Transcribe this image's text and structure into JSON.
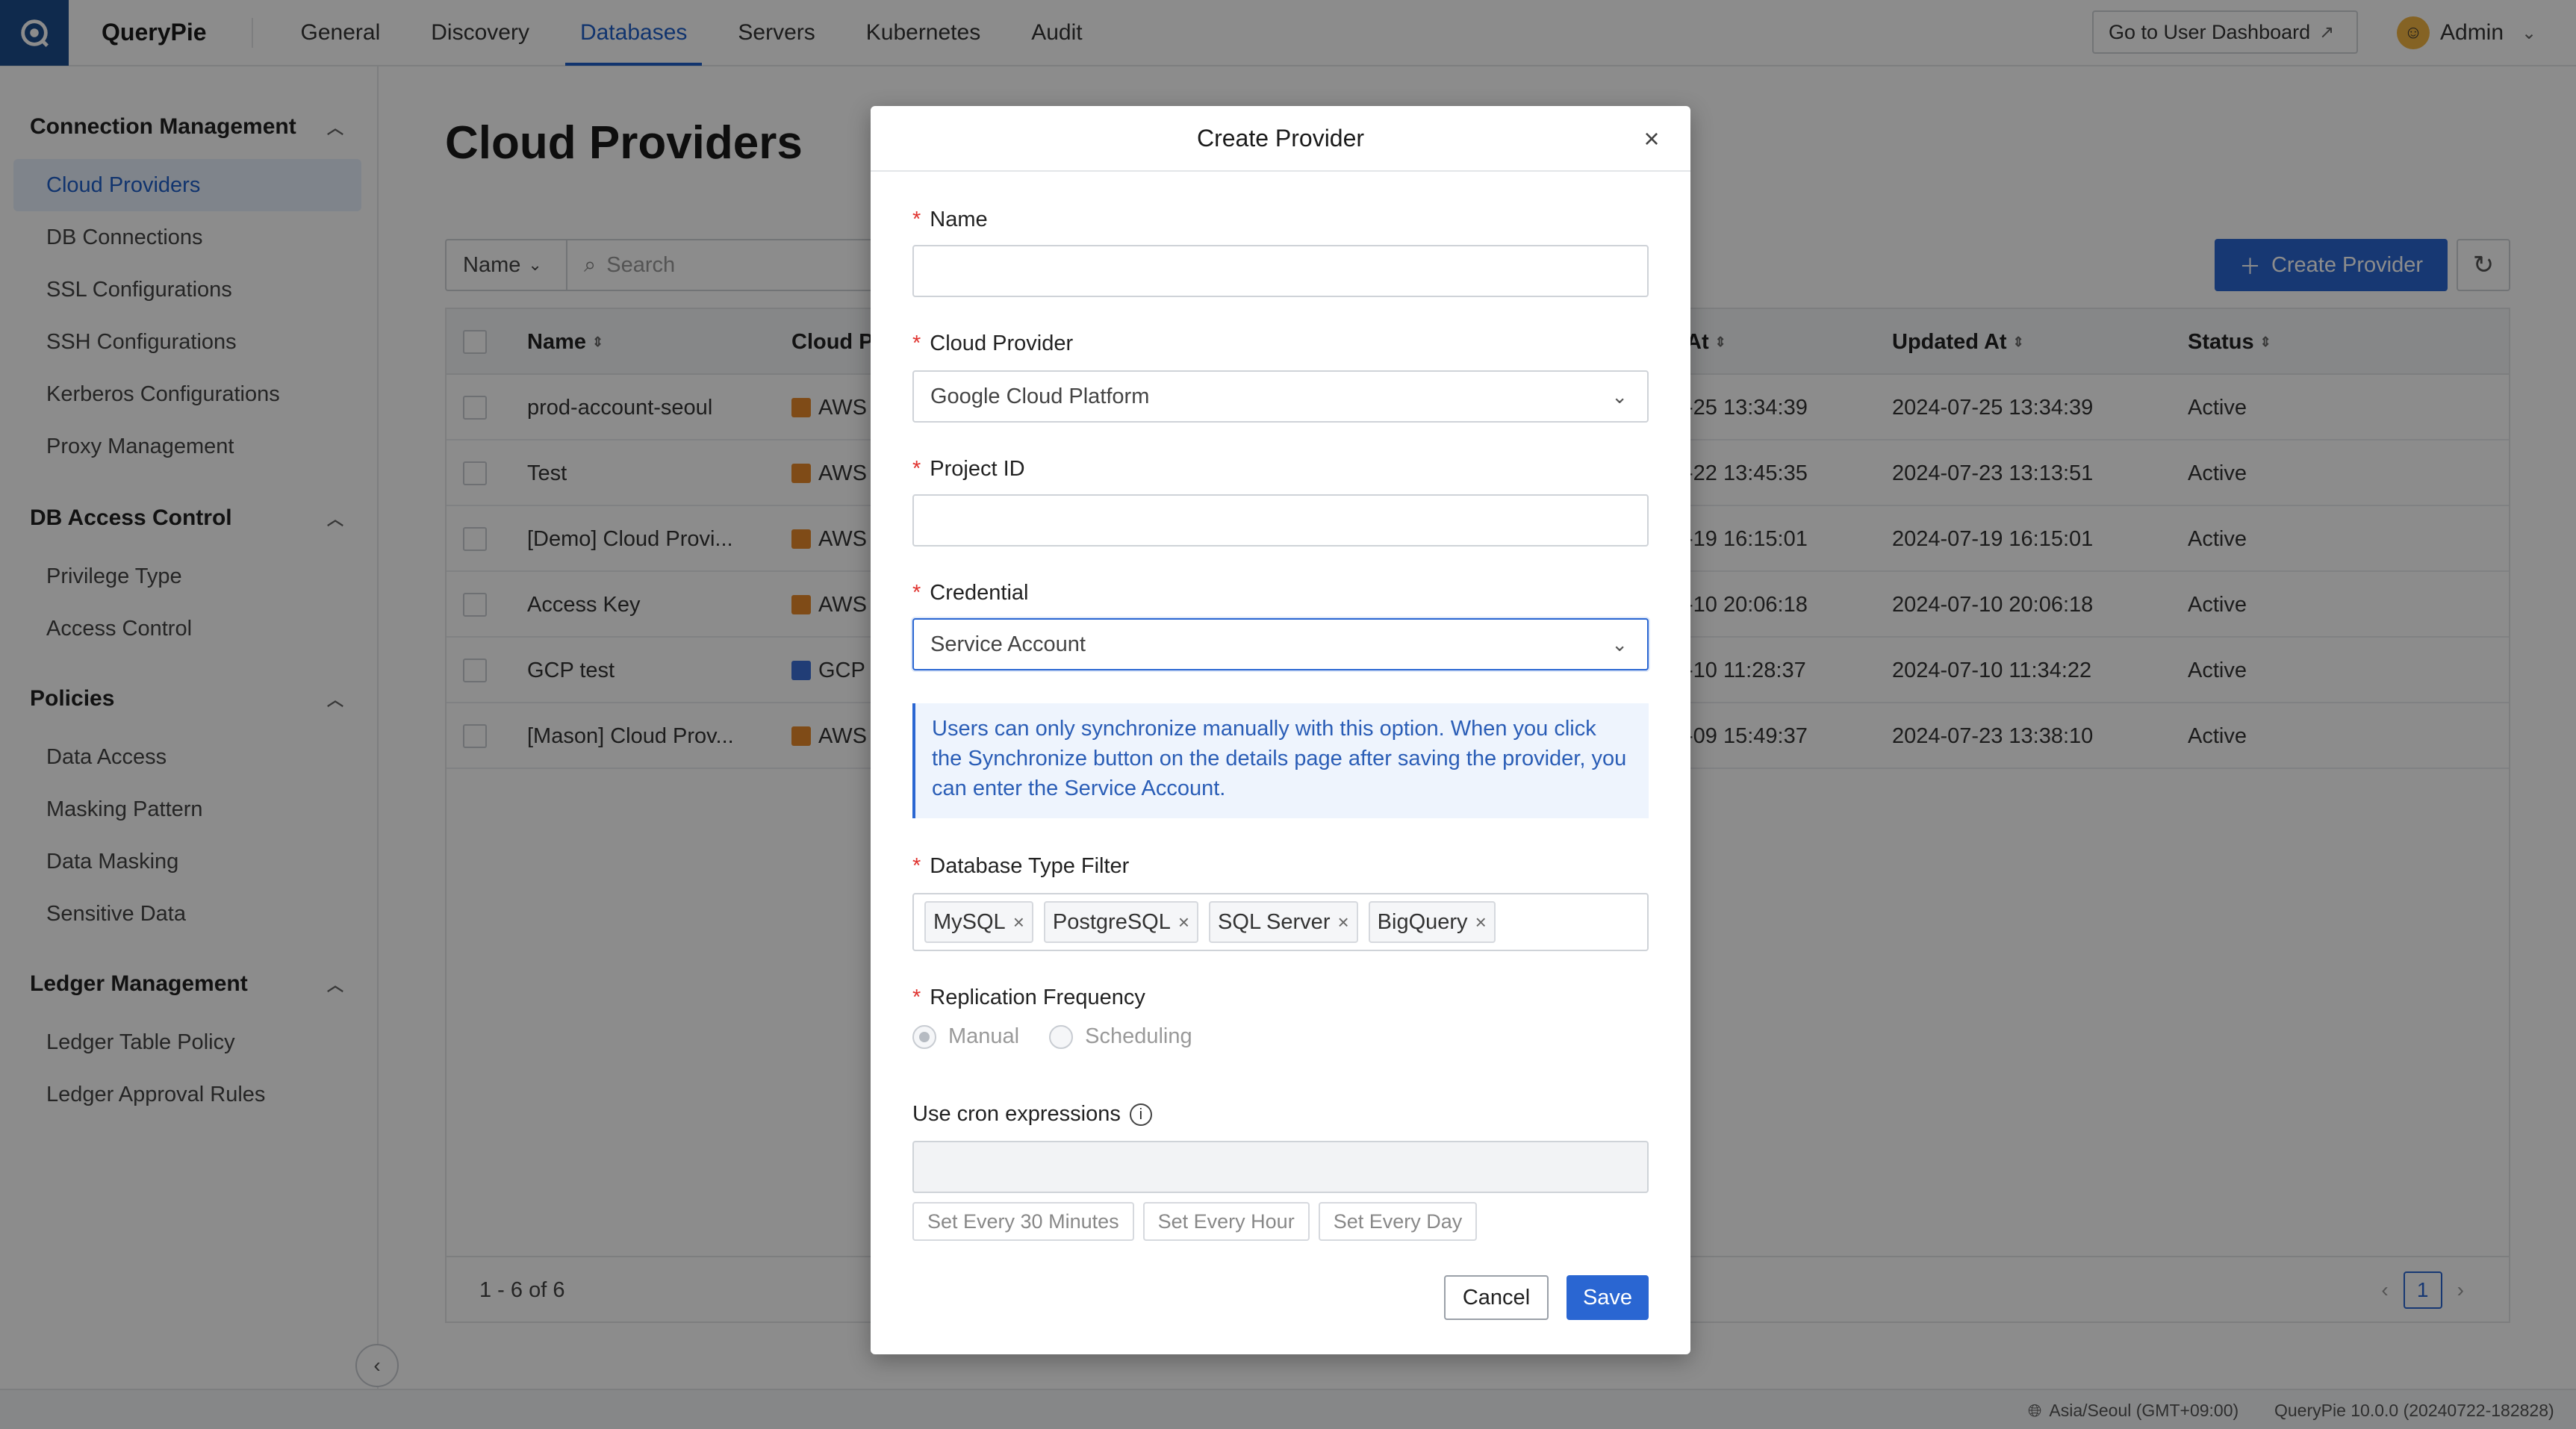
{
  "app": {
    "brand": "QueryPie"
  },
  "nav": {
    "items": [
      {
        "label": "General",
        "active": false
      },
      {
        "label": "Discovery",
        "active": false
      },
      {
        "label": "Databases",
        "active": true
      },
      {
        "label": "Servers",
        "active": false
      },
      {
        "label": "Kubernetes",
        "active": false
      },
      {
        "label": "Audit",
        "active": false
      }
    ],
    "dashboard_button": "Go to User Dashboard",
    "user": "Admin"
  },
  "sidebar": {
    "sections": [
      {
        "title": "Connection Management",
        "items": [
          "Cloud Providers",
          "DB Connections",
          "SSL Configurations",
          "SSH Configurations",
          "Kerberos Configurations",
          "Proxy Management"
        ]
      },
      {
        "title": "DB Access Control",
        "items": [
          "Privilege Type",
          "Access Control"
        ]
      },
      {
        "title": "Policies",
        "items": [
          "Data Access",
          "Masking Pattern",
          "Data Masking",
          "Sensitive Data"
        ]
      },
      {
        "title": "Ledger Management",
        "items": [
          "Ledger Table Policy",
          "Ledger Approval Rules"
        ]
      }
    ],
    "active_item": "Cloud Providers"
  },
  "page": {
    "title": "Cloud Providers",
    "filter_select": "Name",
    "search_placeholder": "Search",
    "create_button": "Create Provider"
  },
  "table": {
    "headers": {
      "name": "Name",
      "cloud_provider": "Cloud P",
      "created_at": "At",
      "updated_at": "Updated At",
      "status": "Status"
    },
    "rows": [
      {
        "name": "prod-account-seoul",
        "provider": "AWS",
        "created": "-25 13:34:39",
        "updated": "2024-07-25 13:34:39",
        "status": "Active"
      },
      {
        "name": "Test",
        "provider": "AWS",
        "created": "-22 13:45:35",
        "updated": "2024-07-23 13:13:51",
        "status": "Active"
      },
      {
        "name": "[Demo] Cloud Provi...",
        "provider": "AWS",
        "created": "-19 16:15:01",
        "updated": "2024-07-19 16:15:01",
        "status": "Active"
      },
      {
        "name": "Access Key",
        "provider": "AWS",
        "created": "-10 20:06:18",
        "updated": "2024-07-10 20:06:18",
        "status": "Active"
      },
      {
        "name": "GCP test",
        "provider": "GCP",
        "created": "-10 11:28:37",
        "updated": "2024-07-10 11:34:22",
        "status": "Active"
      },
      {
        "name": "[Mason] Cloud Prov...",
        "provider": "AWS",
        "created": "-09 15:49:37",
        "updated": "2024-07-23 13:38:10",
        "status": "Active"
      }
    ],
    "footer_count": "1 - 6 of 6",
    "current_page": "1"
  },
  "modal": {
    "title": "Create Provider",
    "name_label": "Name",
    "name_value": "",
    "cloud_provider_label": "Cloud Provider",
    "cloud_provider_value": "Google Cloud Platform",
    "project_id_label": "Project ID",
    "project_id_value": "",
    "credential_label": "Credential",
    "credential_value": "Service Account",
    "info_text": "Users can only synchronize manually with this option. When you click the Synchronize button on the details page after saving the provider, you can enter the Service Account.",
    "db_type_label": "Database Type Filter",
    "db_types": [
      "MySQL",
      "PostgreSQL",
      "SQL Server",
      "BigQuery"
    ],
    "replication_label": "Replication Frequency",
    "replication_options": [
      "Manual",
      "Scheduling"
    ],
    "replication_selected": "Manual",
    "cron_label": "Use cron expressions",
    "cron_value": "",
    "cron_presets": [
      "Set Every 30 Minutes",
      "Set Every Hour",
      "Set Every Day"
    ],
    "cancel_label": "Cancel",
    "save_label": "Save"
  },
  "status_bar": {
    "timezone": "Asia/Seoul (GMT+09:00)",
    "version": "QueryPie 10.0.0 (20240722-182828)"
  },
  "colors": {
    "accent": "#2a66d2",
    "aws": "#e8892a",
    "gcp": "#3d6fd8"
  }
}
